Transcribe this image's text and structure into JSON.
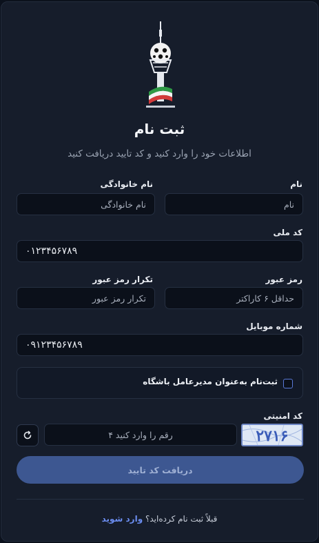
{
  "logo": {
    "name": "milad-tower-club-logo"
  },
  "header": {
    "title": "ثبت نام",
    "subtitle": "اطلاعات خود را وارد کنید و کد تایید دریافت کنید"
  },
  "form": {
    "first_name": {
      "label": "نام",
      "placeholder": "نام"
    },
    "last_name": {
      "label": "نام خانوادگی",
      "placeholder": "نام خانوادگی"
    },
    "national_code": {
      "label": "کد ملی",
      "value": "۰۱۲۳۴۵۶۷۸۹"
    },
    "password": {
      "label": "رمز عبور",
      "placeholder": "حداقل ۶ کاراکتر"
    },
    "password_confirm": {
      "label": "تکرار رمز عبور",
      "placeholder": "تکرار رمز عبور"
    },
    "mobile": {
      "label": "شماره موبایل",
      "value": "۰۹۱۲۳۴۵۶۷۸۹"
    },
    "manager_checkbox": {
      "label": "ثبت‌نام به‌عنوان مدیرعامل باشگاه",
      "checked": false
    },
    "captcha": {
      "label": "کد امنیتی",
      "placeholder": "رقم را وارد کنید ۴",
      "image_text": "۲۷۱۶",
      "refresh_icon": "refresh-icon"
    },
    "submit_label": "دریافت کد تایید"
  },
  "footer": {
    "text": "قبلاً ثبت نام کرده‌اید؟",
    "link": "وارد شوید"
  },
  "colors": {
    "background": "#0b111c",
    "card": "#161d2b",
    "input": "#0b101a",
    "accent": "#3d5791",
    "link": "#6b8df0"
  }
}
